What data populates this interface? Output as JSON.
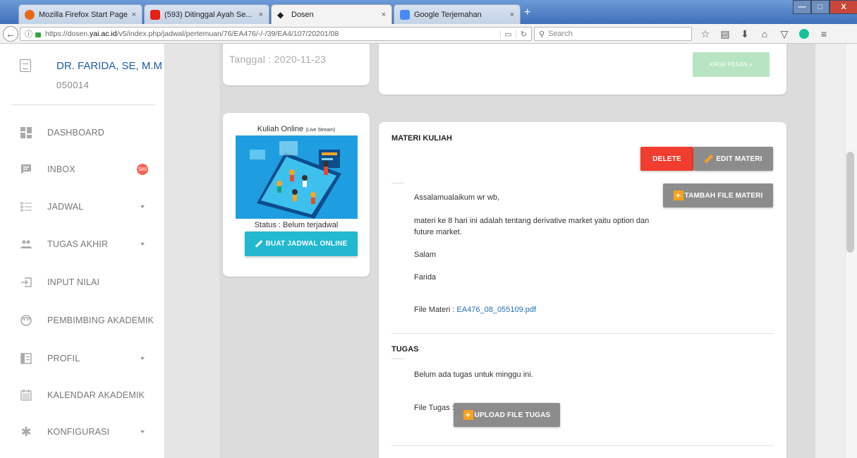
{
  "browser": {
    "tabs": [
      {
        "label": "Mozilla Firefox Start Page",
        "close": "×",
        "fav": "#e66a1c"
      },
      {
        "label": "(593) Ditinggal Ayah Se... ◀)",
        "close": "×",
        "fav": "#e62117"
      },
      {
        "label": "Dosen",
        "close": "×",
        "fav": "#222222"
      },
      {
        "label": "Google Terjemahan",
        "close": "×",
        "fav": "#4a8af4"
      }
    ],
    "new_tab": "+",
    "window_controls": {
      "minimize": "—",
      "maximize": "□",
      "close": "X"
    },
    "url_prefix": "https://dosen.",
    "url_domain": "yai.ac.id",
    "url_rest": "/v5/index.php/jadwal/pertemuan/76/EA476/-/-/39/EA4/107/20201/08",
    "search_placeholder": "Search"
  },
  "sidebar": {
    "user_name": "DR. FARIDA, SE, M.M",
    "user_id": "050014",
    "items": [
      {
        "label": "DASHBOARD",
        "icon": "dashboard-icon"
      },
      {
        "label": "INBOX",
        "icon": "inbox-icon",
        "badge": "589"
      },
      {
        "label": "JADWAL",
        "icon": "list-icon"
      },
      {
        "label": "TUGAS AKHIR",
        "icon": "users-icon"
      },
      {
        "label": "INPUT NILAI",
        "icon": "login-icon"
      },
      {
        "label": "PEMBIMBING AKADEMIK",
        "icon": "face-icon"
      },
      {
        "label": "PROFIL",
        "icon": "profile-icon"
      },
      {
        "label": "KALENDAR AKADEMIK",
        "icon": "calendar-icon"
      },
      {
        "label": "KONFIGURASI",
        "icon": "gear-icon"
      }
    ]
  },
  "main": {
    "tanggal": "Tanggal : 2020-11-23",
    "kirim_pesan": "KIRIM PESAN »",
    "live": {
      "title": "Kuliah Online",
      "title_small": "(Live Stream)",
      "status": "Status : Belum terjadwal",
      "button": "BUAT JADWAL ONLINE"
    },
    "materi": {
      "title": "MATERI KULIAH",
      "delete": "DELETE",
      "edit": "EDIT MATERI",
      "tambah": "TAMBAH FILE MATERI",
      "p1": "Assalamualaikum wr wb,",
      "p2a": "materi ke 8 hari ini adalah tentang derivative market yaitu option dan",
      "p2b": "future market.",
      "p3": "Salam",
      "p4": "Farida",
      "file_label": "File Materi : ",
      "file_link": "EA476_08_055109.pdf"
    },
    "tugas": {
      "title": "TUGAS",
      "text": "Belum ada tugas untuk minggu ini.",
      "file_label": "File Tugas :",
      "upload": "UPLOAD FILE TUGAS"
    }
  },
  "colors": {
    "delete": "#f13c30",
    "grey_button": "#8c8c8c",
    "live_button": "#22b8cf",
    "kirim_button": "#b7e4c2",
    "link": "#1f6fb5"
  }
}
